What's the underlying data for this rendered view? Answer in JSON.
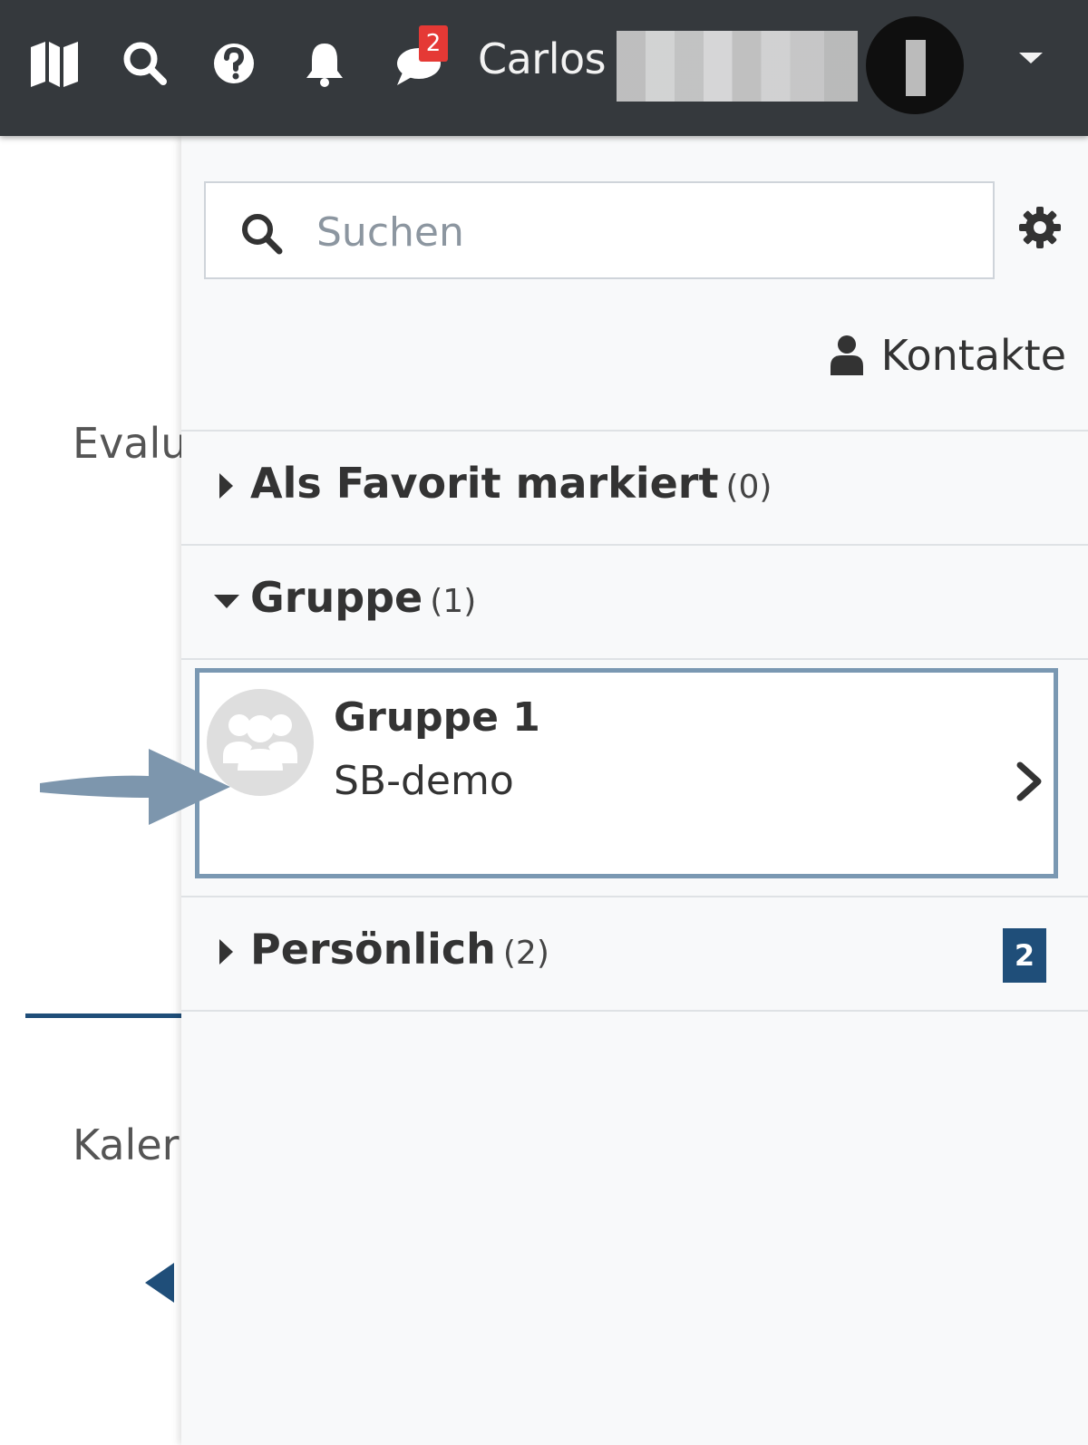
{
  "navbar": {
    "user_name": "Carlos",
    "message_badge": "2",
    "icons": [
      "map-icon",
      "search-icon",
      "help-icon",
      "bell-icon",
      "chat-icon",
      "chevron-down-icon"
    ]
  },
  "background": {
    "partial_texts": [
      "Evalu",
      "Kaler"
    ]
  },
  "drawer": {
    "search": {
      "placeholder": "Suchen",
      "value": ""
    },
    "contacts_label": "Kontakte",
    "sections": [
      {
        "title": "Als Favorit markiert",
        "count": "(0)",
        "expanded": false
      },
      {
        "title": "Gruppe",
        "count": "(1)",
        "expanded": true,
        "items": [
          {
            "name": "Gruppe 1",
            "subtitle": "SB-demo"
          }
        ]
      },
      {
        "title": "Persönlich",
        "count": "(2)",
        "expanded": false,
        "unread": "2"
      }
    ]
  },
  "colors": {
    "navbar_bg": "#35393d",
    "accent": "#1f4e79",
    "badge_red": "#e53935",
    "card_border": "#7a98b2",
    "annotation_arrow": "#7d96ad"
  }
}
